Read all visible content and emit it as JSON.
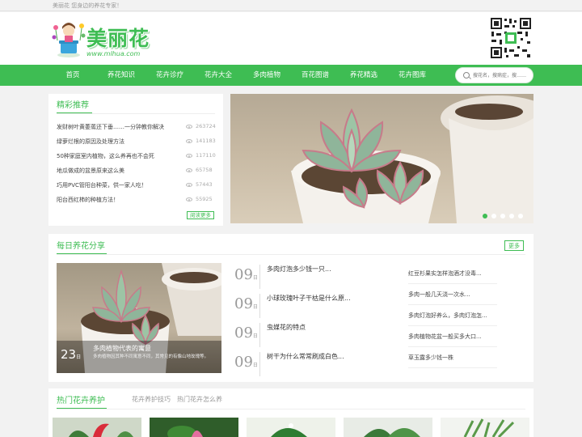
{
  "topbar": {
    "text": "美丽花 您身边的养花专家！"
  },
  "header": {
    "logo_text": "美丽花",
    "logo_url": "www.mlhua.com"
  },
  "nav": {
    "items": [
      "首页",
      "养花知识",
      "花卉诊疗",
      "花卉大全",
      "多肉植物",
      "百花图谱",
      "养花精选",
      "花卉图库"
    ],
    "search_placeholder": "搜花名，搜病症，搜……"
  },
  "recommend": {
    "title": "精彩推荐",
    "items": [
      {
        "title": "发财树叶黄萎蔫还下垂……一分钟教你解决",
        "views": "263724"
      },
      {
        "title": "绿萝烂根的原因及处理方法",
        "views": "141183"
      },
      {
        "title": "50种家庭室内植物，这么养再也不会死",
        "views": "117110"
      },
      {
        "title": "地瓜做成的盆景原来这么美",
        "views": "65758"
      },
      {
        "title": "巧用PVC管阳台种菜，供一家人吃！",
        "views": "57443"
      },
      {
        "title": "阳台西红柿的种植方法！",
        "views": "55925"
      }
    ],
    "more_label": "阅读更多"
  },
  "slider": {
    "dot_count": 5,
    "active_dot": 0
  },
  "daily": {
    "title": "每日养花分享",
    "more_label": "更多",
    "feature": {
      "day": "23",
      "unit": "日",
      "caption": "多肉植物代表的寓意",
      "summary": "多肉植物因其种不同寓意不同，其常见的有像山地玫瑰等。"
    },
    "middle": [
      {
        "day": "09",
        "unit": "日",
        "title": "多肉灯泡多少钱一只..."
      },
      {
        "day": "09",
        "unit": "日",
        "title": "小球玫瑰叶子干枯是什么原..."
      },
      {
        "day": "09",
        "unit": "日",
        "title": "虫媒花的特点"
      },
      {
        "day": "09",
        "unit": "日",
        "title": "树干为什么常常刷成白色..."
      }
    ],
    "right": [
      "红豆杉果实怎样泡酒才没毒...",
      "多肉一般几天浇一次水...",
      "多肉灯泡好养么，多肉灯泡怎...",
      "多肉植物花盆一般买多大口...",
      "草玉露多少钱一株"
    ]
  },
  "hot": {
    "title": "热门花卉养护",
    "tabs": [
      "花卉养护技巧",
      "热门花卉怎么养"
    ]
  },
  "colors": {
    "brand": "#3ebd53",
    "page_bg": "#f2f2f2"
  }
}
